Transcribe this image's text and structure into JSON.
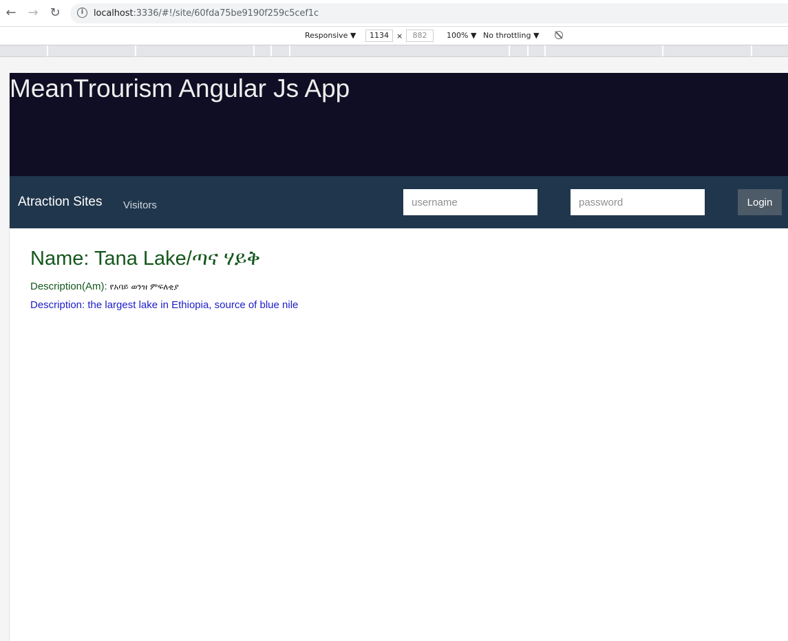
{
  "browser": {
    "url_host": "localhost",
    "url_path": ":3336/#!/site/60fda75be9190f259c5cef1c"
  },
  "devtools": {
    "device": "Responsive ▼",
    "width": "1134",
    "times": "×",
    "height": "882",
    "zoom": "100% ▼",
    "throttling": "No throttling ▼"
  },
  "app": {
    "title": "MeanTrourism Angular Js App",
    "nav": {
      "brand": "Atraction Sites",
      "visitors_link": "Visitors",
      "username_placeholder": "username",
      "password_placeholder": "password",
      "login_label": "Login"
    },
    "site": {
      "name": "Name: Tana Lake/ጣና ሃይቅ",
      "description_am_label": "Description(Am):",
      "description_am": " የአባይ ወንዝ ምፍለቂያ",
      "description_en": "Description: the largest lake in Ethiopia, source of blue nile"
    }
  }
}
